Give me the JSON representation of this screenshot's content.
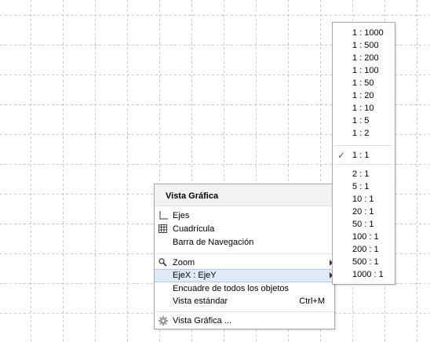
{
  "context_menu": {
    "title": "Vista Gráfica",
    "items": [
      {
        "label": "Ejes",
        "icon": "axes-icon"
      },
      {
        "label": "Cuadrícula",
        "icon": "grid-icon"
      },
      {
        "label": "Barra de Navegación",
        "icon": ""
      },
      {
        "label": "Zoom",
        "icon": "magnifier-icon",
        "submenu": true
      },
      {
        "label": "EjeX : EjeY",
        "icon": "",
        "submenu": true,
        "highlighted": true
      },
      {
        "label": "Encuadre de todos los objetos",
        "icon": ""
      },
      {
        "label": "Vista estándar",
        "icon": "",
        "shortcut": "Ctrl+M"
      },
      {
        "label": "Vista Gráfica ...",
        "icon": "gear-icon"
      }
    ]
  },
  "ratio_submenu": {
    "items": [
      "1 : 1000",
      "1 : 500",
      "1 : 200",
      "1 : 100",
      "1 : 50",
      "1 : 20",
      "1 : 10",
      "1 : 5",
      "1 : 2",
      "1 : 1",
      "2 : 1",
      "5 : 1",
      "10 : 1",
      "20 : 1",
      "50 : 1",
      "100 : 1",
      "200 : 1",
      "500 : 1",
      "1000 : 1"
    ],
    "selected": "1 : 1",
    "check_mark": "✓"
  },
  "colors": {
    "grid_line": "#c8c8c8",
    "highlight_bg": "#dfe9f7",
    "menu_border": "#a8a8a8",
    "header_bg": "#f2f2f2",
    "check": "#2f5fa8"
  }
}
